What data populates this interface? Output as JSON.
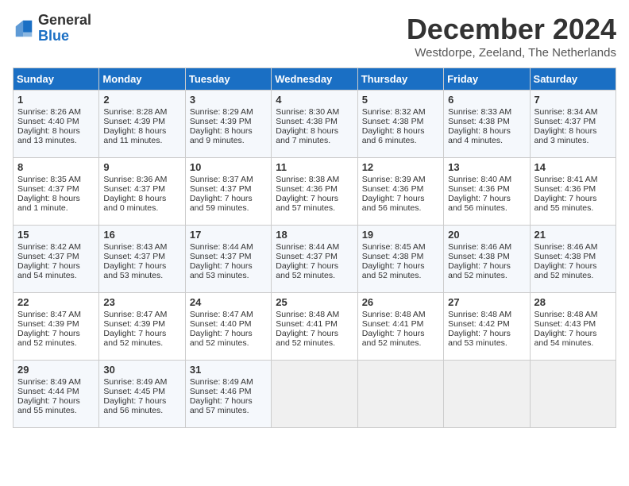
{
  "logo": {
    "general": "General",
    "blue": "Blue"
  },
  "title": "December 2024",
  "location": "Westdorpe, Zeeland, The Netherlands",
  "headers": [
    "Sunday",
    "Monday",
    "Tuesday",
    "Wednesday",
    "Thursday",
    "Friday",
    "Saturday"
  ],
  "weeks": [
    [
      {
        "day": "1",
        "info": "Sunrise: 8:26 AM\nSunset: 4:40 PM\nDaylight: 8 hours and 13 minutes."
      },
      {
        "day": "2",
        "info": "Sunrise: 8:28 AM\nSunset: 4:39 PM\nDaylight: 8 hours and 11 minutes."
      },
      {
        "day": "3",
        "info": "Sunrise: 8:29 AM\nSunset: 4:39 PM\nDaylight: 8 hours and 9 minutes."
      },
      {
        "day": "4",
        "info": "Sunrise: 8:30 AM\nSunset: 4:38 PM\nDaylight: 8 hours and 7 minutes."
      },
      {
        "day": "5",
        "info": "Sunrise: 8:32 AM\nSunset: 4:38 PM\nDaylight: 8 hours and 6 minutes."
      },
      {
        "day": "6",
        "info": "Sunrise: 8:33 AM\nSunset: 4:38 PM\nDaylight: 8 hours and 4 minutes."
      },
      {
        "day": "7",
        "info": "Sunrise: 8:34 AM\nSunset: 4:37 PM\nDaylight: 8 hours and 3 minutes."
      }
    ],
    [
      {
        "day": "8",
        "info": "Sunrise: 8:35 AM\nSunset: 4:37 PM\nDaylight: 8 hours and 1 minute."
      },
      {
        "day": "9",
        "info": "Sunrise: 8:36 AM\nSunset: 4:37 PM\nDaylight: 8 hours and 0 minutes."
      },
      {
        "day": "10",
        "info": "Sunrise: 8:37 AM\nSunset: 4:37 PM\nDaylight: 7 hours and 59 minutes."
      },
      {
        "day": "11",
        "info": "Sunrise: 8:38 AM\nSunset: 4:36 PM\nDaylight: 7 hours and 57 minutes."
      },
      {
        "day": "12",
        "info": "Sunrise: 8:39 AM\nSunset: 4:36 PM\nDaylight: 7 hours and 56 minutes."
      },
      {
        "day": "13",
        "info": "Sunrise: 8:40 AM\nSunset: 4:36 PM\nDaylight: 7 hours and 56 minutes."
      },
      {
        "day": "14",
        "info": "Sunrise: 8:41 AM\nSunset: 4:36 PM\nDaylight: 7 hours and 55 minutes."
      }
    ],
    [
      {
        "day": "15",
        "info": "Sunrise: 8:42 AM\nSunset: 4:37 PM\nDaylight: 7 hours and 54 minutes."
      },
      {
        "day": "16",
        "info": "Sunrise: 8:43 AM\nSunset: 4:37 PM\nDaylight: 7 hours and 53 minutes."
      },
      {
        "day": "17",
        "info": "Sunrise: 8:44 AM\nSunset: 4:37 PM\nDaylight: 7 hours and 53 minutes."
      },
      {
        "day": "18",
        "info": "Sunrise: 8:44 AM\nSunset: 4:37 PM\nDaylight: 7 hours and 52 minutes."
      },
      {
        "day": "19",
        "info": "Sunrise: 8:45 AM\nSunset: 4:38 PM\nDaylight: 7 hours and 52 minutes."
      },
      {
        "day": "20",
        "info": "Sunrise: 8:46 AM\nSunset: 4:38 PM\nDaylight: 7 hours and 52 minutes."
      },
      {
        "day": "21",
        "info": "Sunrise: 8:46 AM\nSunset: 4:38 PM\nDaylight: 7 hours and 52 minutes."
      }
    ],
    [
      {
        "day": "22",
        "info": "Sunrise: 8:47 AM\nSunset: 4:39 PM\nDaylight: 7 hours and 52 minutes."
      },
      {
        "day": "23",
        "info": "Sunrise: 8:47 AM\nSunset: 4:39 PM\nDaylight: 7 hours and 52 minutes."
      },
      {
        "day": "24",
        "info": "Sunrise: 8:47 AM\nSunset: 4:40 PM\nDaylight: 7 hours and 52 minutes."
      },
      {
        "day": "25",
        "info": "Sunrise: 8:48 AM\nSunset: 4:41 PM\nDaylight: 7 hours and 52 minutes."
      },
      {
        "day": "26",
        "info": "Sunrise: 8:48 AM\nSunset: 4:41 PM\nDaylight: 7 hours and 52 minutes."
      },
      {
        "day": "27",
        "info": "Sunrise: 8:48 AM\nSunset: 4:42 PM\nDaylight: 7 hours and 53 minutes."
      },
      {
        "day": "28",
        "info": "Sunrise: 8:48 AM\nSunset: 4:43 PM\nDaylight: 7 hours and 54 minutes."
      }
    ],
    [
      {
        "day": "29",
        "info": "Sunrise: 8:49 AM\nSunset: 4:44 PM\nDaylight: 7 hours and 55 minutes."
      },
      {
        "day": "30",
        "info": "Sunrise: 8:49 AM\nSunset: 4:45 PM\nDaylight: 7 hours and 56 minutes."
      },
      {
        "day": "31",
        "info": "Sunrise: 8:49 AM\nSunset: 4:46 PM\nDaylight: 7 hours and 57 minutes."
      },
      null,
      null,
      null,
      null
    ]
  ]
}
